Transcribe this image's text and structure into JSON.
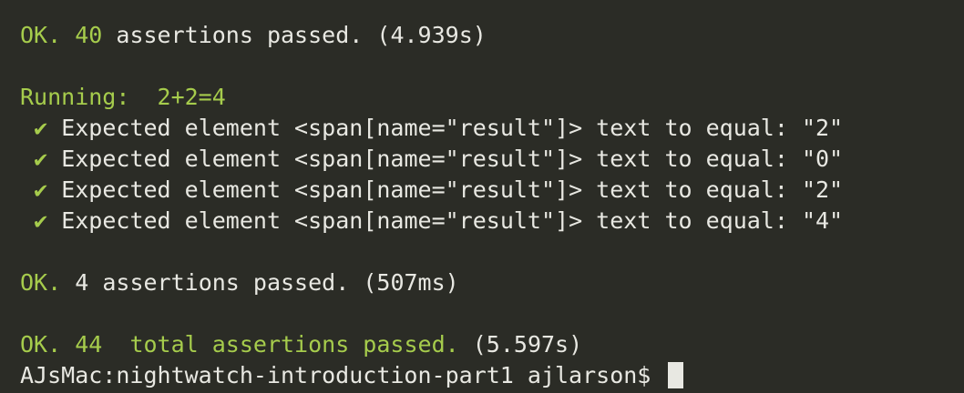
{
  "summary1": {
    "ok": "OK.",
    "count": "40",
    "text": "assertions passed.",
    "time": "(4.939s)"
  },
  "running": {
    "label": "Running:",
    "test_name": "2+2=4"
  },
  "assertions": [
    {
      "check": "✔",
      "text": "Expected element <span[name=\"result\"]> text to equal: \"2\""
    },
    {
      "check": "✔",
      "text": "Expected element <span[name=\"result\"]> text to equal: \"0\""
    },
    {
      "check": "✔",
      "text": "Expected element <span[name=\"result\"]> text to equal: \"2\""
    },
    {
      "check": "✔",
      "text": "Expected element <span[name=\"result\"]> text to equal: \"4\""
    }
  ],
  "summary2": {
    "ok": "OK.",
    "count": "4",
    "text": "assertions passed.",
    "time": "(507ms)"
  },
  "summary3": {
    "ok": "OK.",
    "count": "44",
    "text": "total assertions passed.",
    "time": "(5.597s)"
  },
  "prompt": {
    "text": "AJsMac:nightwatch-introduction-part1 ajlarson$"
  },
  "colors": {
    "background": "#2b2c26",
    "green": "#a6cc4c",
    "text": "#e8e8e2"
  }
}
